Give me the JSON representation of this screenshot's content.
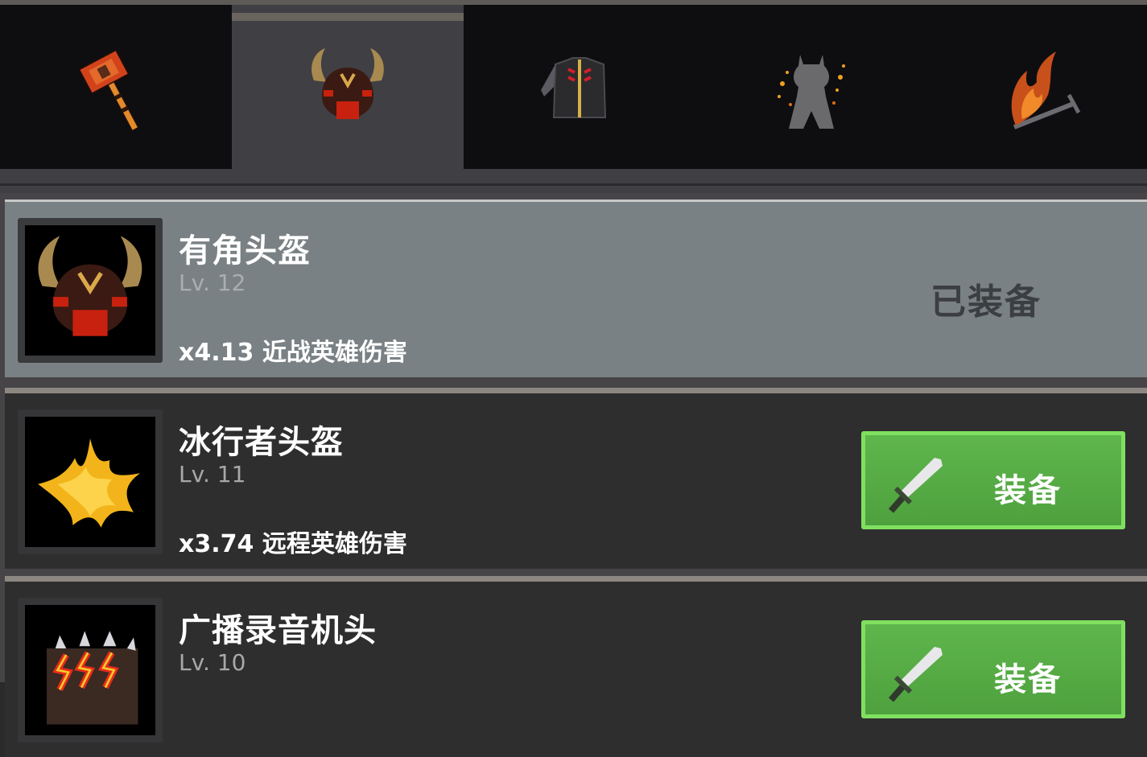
{
  "tabs": [
    {
      "name": "weapon",
      "icon": "hammer-icon",
      "active": false
    },
    {
      "name": "helmet",
      "icon": "horned-helmet-icon",
      "active": true
    },
    {
      "name": "armor",
      "icon": "jacket-icon",
      "active": false
    },
    {
      "name": "hero",
      "icon": "hero-silhouette-icon",
      "active": false
    },
    {
      "name": "flame",
      "icon": "flaming-sword-icon",
      "active": false
    }
  ],
  "items": [
    {
      "name": "有角头盔",
      "level": "Lv. 12",
      "bonus": "x4.13 近战英雄伤害",
      "status": "已装备",
      "icon": "horned-helmet-icon"
    },
    {
      "name": "冰行者头盔",
      "level": "Lv. 11",
      "bonus": "x3.74 远程英雄伤害",
      "button_label": "装备",
      "icon": "golden-spikes-icon"
    },
    {
      "name": "广播录音机头",
      "level": "Lv. 10",
      "button_label": "装备",
      "icon": "spiked-boombox-icon"
    }
  ],
  "colors": {
    "equip_button": "#56ab44",
    "equip_button_border": "#7fe05f",
    "equipped_row": "#7a8184"
  }
}
